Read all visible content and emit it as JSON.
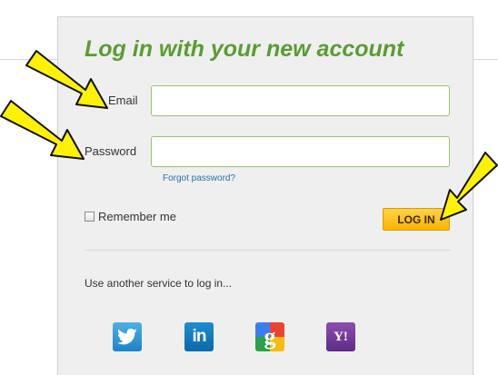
{
  "login": {
    "title": "Log in with your new account",
    "email_label": "Email",
    "email_value": "",
    "password_label": "Password",
    "password_value": "",
    "forgot_password": "Forgot password?",
    "remember_me": "Remember me",
    "login_button": "LOG IN"
  },
  "services": {
    "heading": "Use another service to log in...",
    "items": [
      {
        "name": "twitter",
        "icon": "twitter-icon"
      },
      {
        "name": "linkedin",
        "icon": "linkedin-icon",
        "glyph": "in"
      },
      {
        "name": "google",
        "icon": "google-icon",
        "glyph": "g"
      },
      {
        "name": "yahoo",
        "icon": "yahoo-icon",
        "glyph": "Y!"
      }
    ]
  },
  "colors": {
    "title_green": "#5c9b34",
    "field_border": "#98c36e",
    "button_yellow": "#ffb300",
    "link_blue": "#2f6fa8",
    "annotation_arrow": "#fff200"
  },
  "annotations": [
    {
      "icon": "arrow-icon",
      "points_to": "email-field"
    },
    {
      "icon": "arrow-icon",
      "points_to": "password-field"
    },
    {
      "icon": "arrow-icon",
      "points_to": "login-button"
    }
  ]
}
